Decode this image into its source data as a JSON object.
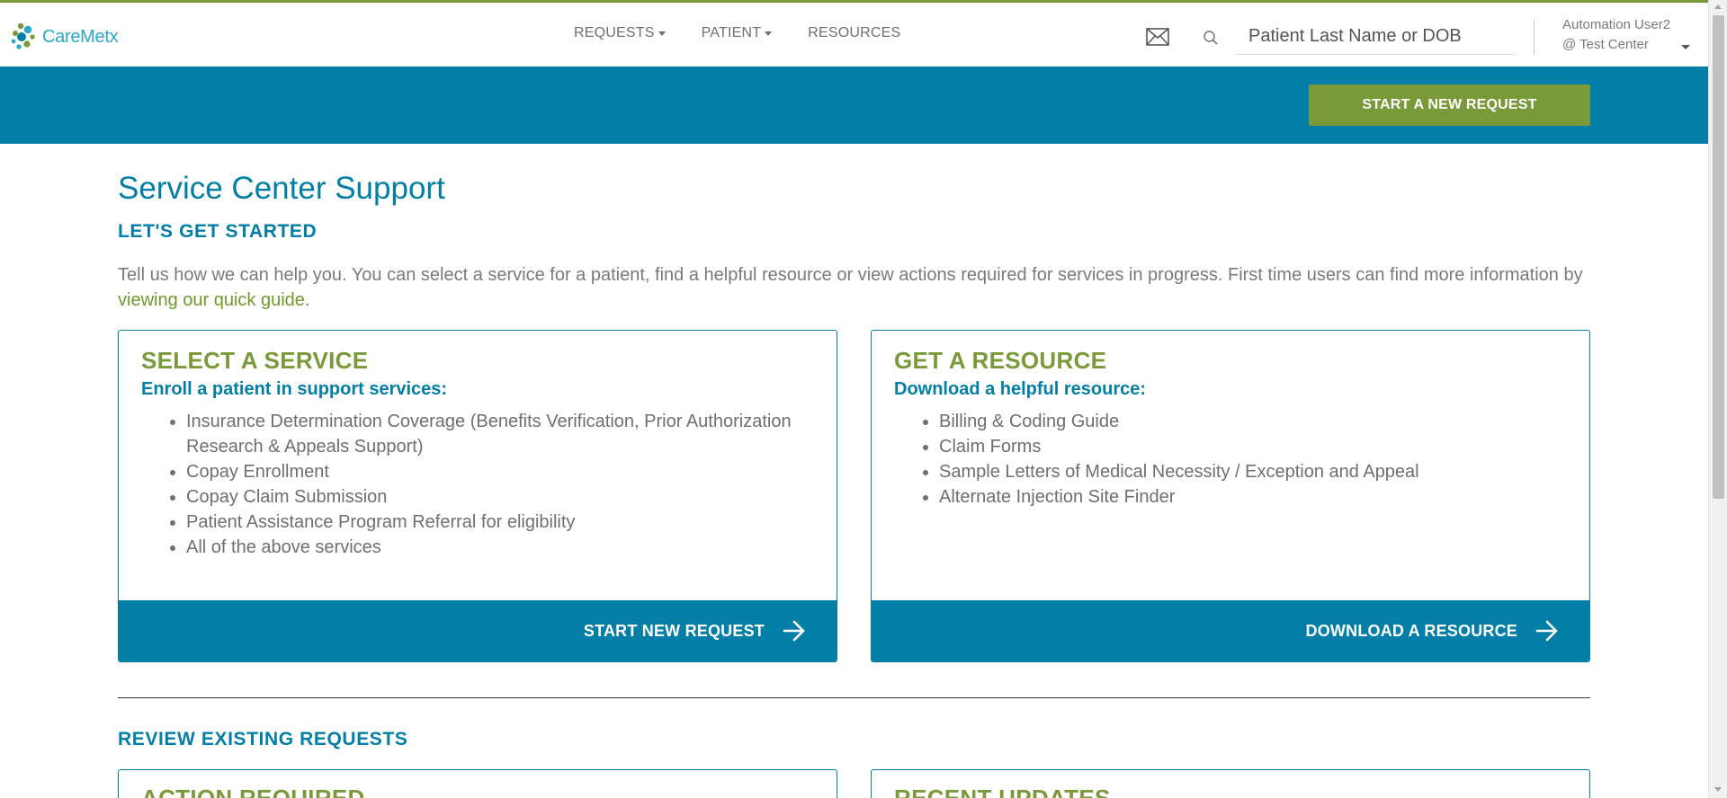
{
  "brand": {
    "logo_text": "CareMetx",
    "accent_green": "#7a9a3a",
    "accent_blue": "#037ea6"
  },
  "header": {
    "nav": [
      {
        "label": "REQUESTS",
        "has_dropdown": true
      },
      {
        "label": "PATIENT",
        "has_dropdown": true
      },
      {
        "label": "RESOURCES",
        "has_dropdown": false
      }
    ],
    "icons": {
      "mail": "mail-icon",
      "search": "search-icon"
    },
    "search": {
      "placeholder": "Patient Last Name or DOB",
      "value": ""
    },
    "user": {
      "name": "Automation User2",
      "center": "@ Test Center"
    }
  },
  "banner": {
    "start_button": "START A NEW REQUEST"
  },
  "page": {
    "title": "Service Center Support",
    "subtitle": "LET'S GET STARTED",
    "intro_text": "Tell us how we can help you. You can select a service for a patient, find a helpful resource or view actions required for services in progress. First time users can find more information by ",
    "intro_link": "viewing our quick guide",
    "intro_end": "."
  },
  "cards": [
    {
      "heading": "SELECT A SERVICE",
      "subheading": "Enroll a patient in support services:",
      "items": [
        "Insurance Determination Coverage (Benefits Verification, Prior Authorization Research & Appeals Support)",
        "Copay Enrollment",
        "Copay Claim Submission",
        "Patient Assistance Program Referral for eligibility",
        "All of the above services"
      ],
      "action": "START NEW REQUEST"
    },
    {
      "heading": "GET A RESOURCE",
      "subheading": "Download a helpful resource:",
      "items": [
        "Billing & Coding Guide",
        "Claim Forms",
        "Sample Letters of Medical Necessity / Exception and Appeal",
        "Alternate Injection Site Finder"
      ],
      "action": "DOWNLOAD A RESOURCE"
    }
  ],
  "review": {
    "title": "REVIEW EXISTING REQUESTS",
    "cards": [
      {
        "heading": "ACTION REQUIRED"
      },
      {
        "heading": "RECENT UPDATES"
      }
    ]
  }
}
